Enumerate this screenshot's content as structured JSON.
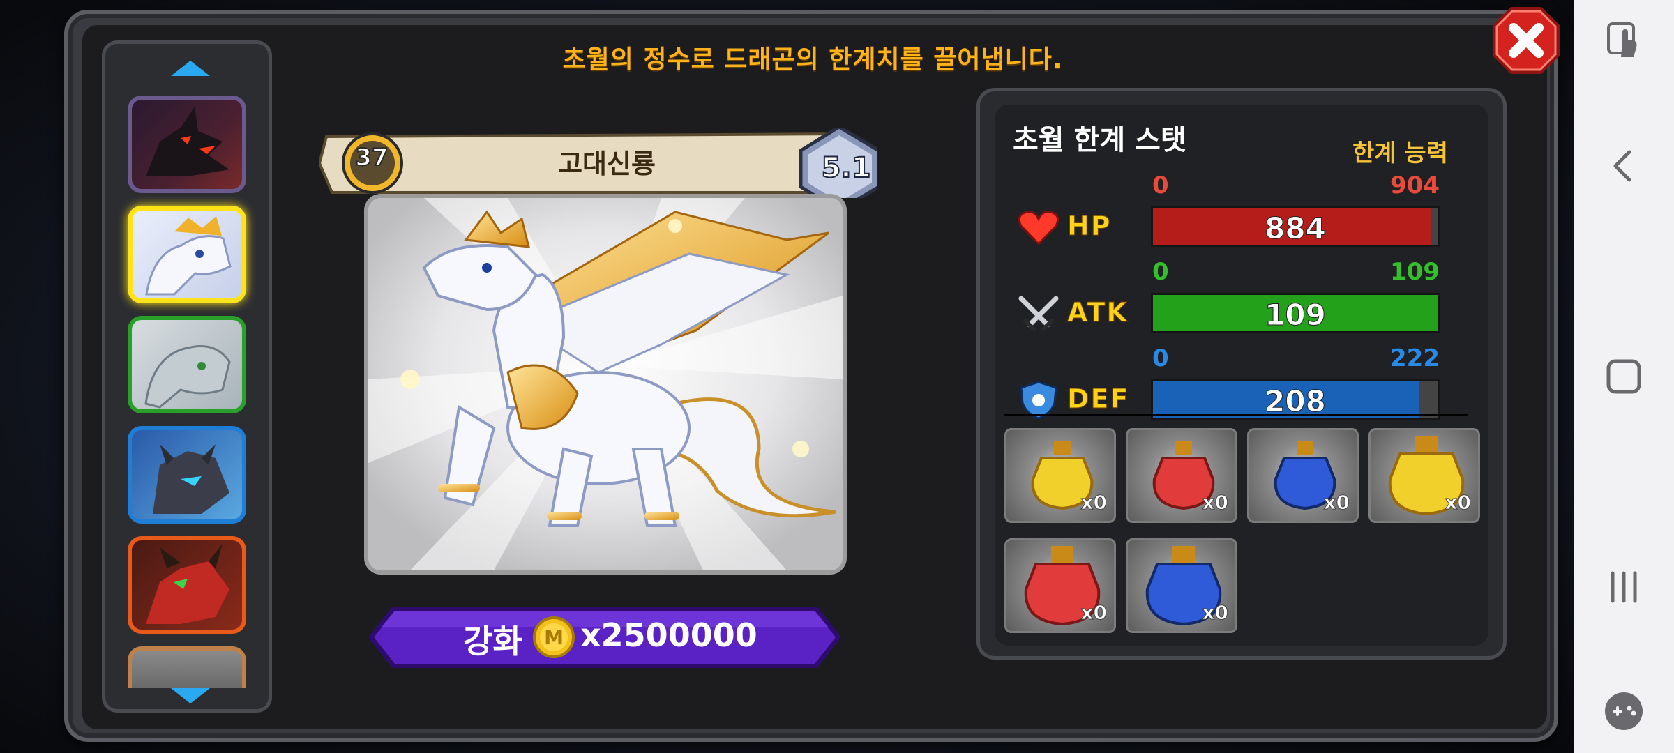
{
  "header": {
    "title": "초월의 정수로 드래곤의 한계치를 끌어냅니다."
  },
  "dragon": {
    "name": "고대신룡",
    "level": "37",
    "grade": "5.1"
  },
  "enhance": {
    "label": "강화",
    "cost": "x2500000",
    "coin_mark": "M"
  },
  "stats": {
    "title": "초월 한계 스탯",
    "limit_label": "한계 능력",
    "items": [
      {
        "name": "HP",
        "min": "0",
        "max": "904",
        "value": "884",
        "fill": 0.978,
        "color": "#b51d1b",
        "min_color": "#e84a3b",
        "max_color": "#e84a3b"
      },
      {
        "name": "ATK",
        "min": "0",
        "max": "109",
        "value": "109",
        "fill": 1.0,
        "color": "#23a11a",
        "min_color": "#33c02a",
        "max_color": "#33c02a"
      },
      {
        "name": "DEF",
        "min": "0",
        "max": "222",
        "value": "208",
        "fill": 0.937,
        "color": "#1a62b7",
        "min_color": "#2a8ae8",
        "max_color": "#2a8ae8"
      }
    ]
  },
  "potions": [
    {
      "name": "yellow-potion",
      "count": "x0",
      "color": "#f2d02b"
    },
    {
      "name": "red-potion",
      "count": "x0",
      "color": "#e23b3b"
    },
    {
      "name": "blue-potion",
      "count": "x0",
      "color": "#2f5ad8"
    },
    {
      "name": "large-yellow-potion",
      "count": "x0",
      "color": "#f2d02b"
    },
    {
      "name": "large-red-potion",
      "count": "x0",
      "color": "#e23b3b"
    },
    {
      "name": "large-blue-potion",
      "count": "x0",
      "color": "#2f5ad8"
    }
  ],
  "dragon_list": [
    {
      "name": "dragon-thumb-dark",
      "frame": "#6a5a8e",
      "selected": false
    },
    {
      "name": "dragon-thumb-ancient",
      "frame": "#ffe21a",
      "selected": true
    },
    {
      "name": "dragon-thumb-green",
      "frame": "#28a02a",
      "selected": false
    },
    {
      "name": "dragon-thumb-blue",
      "frame": "#1f7ed6",
      "selected": false
    },
    {
      "name": "dragon-thumb-red",
      "frame": "#e85a1a",
      "selected": false
    },
    {
      "name": "dragon-thumb-partial",
      "frame": "#c0804a",
      "selected": false
    }
  ],
  "colors": {
    "title": "#ffb319",
    "limit_label": "#f5c338",
    "enhance_button": "#5a22c4",
    "close_button": "#d4231f"
  }
}
